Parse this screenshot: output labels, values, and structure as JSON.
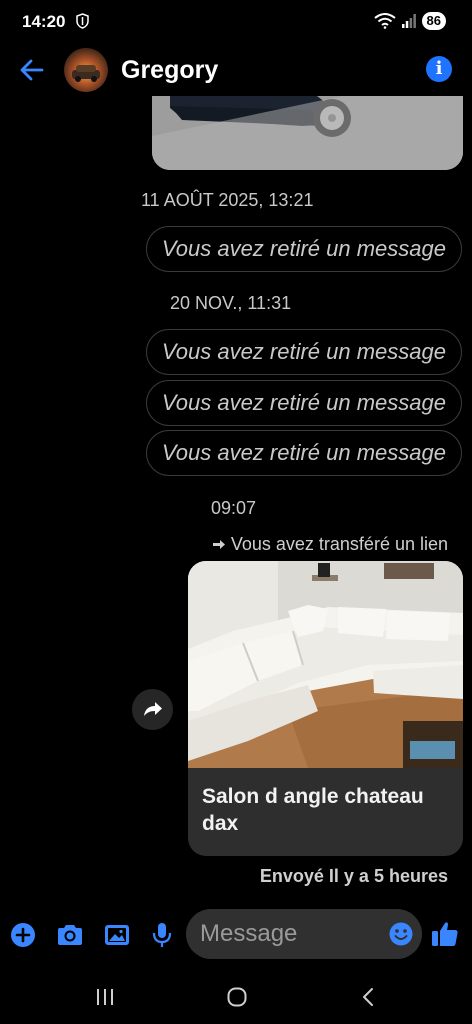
{
  "status_bar": {
    "time": "14:20",
    "battery": "86"
  },
  "header": {
    "contact_name": "Gregory"
  },
  "thread": {
    "timestamps": [
      "11 AOÛT 2025, 13:21",
      "20 NOV., 11:31",
      "09:07"
    ],
    "unsent_messages": [
      "Vous avez retiré un message",
      "Vous avez retiré un message",
      "Vous avez retiré un message",
      "Vous avez retiré un message"
    ],
    "forward_label": "Vous avez transféré un lien",
    "link_card": {
      "title": "Salon d angle chateau dax"
    },
    "sent_status": "Envoyé Il y a 5 heures"
  },
  "composer": {
    "placeholder": "Message"
  },
  "colors": {
    "accent": "#1e73ff",
    "background": "#000000",
    "bubble_border": "#3a3a3a",
    "input_bg": "#303030"
  },
  "icons": {
    "composer": [
      "plus-circle-icon",
      "camera-icon",
      "image-icon",
      "microphone-icon",
      "emoji-icon",
      "thumbs-up-icon"
    ],
    "navbar": [
      "recent-apps-icon",
      "home-icon",
      "back-icon"
    ]
  }
}
